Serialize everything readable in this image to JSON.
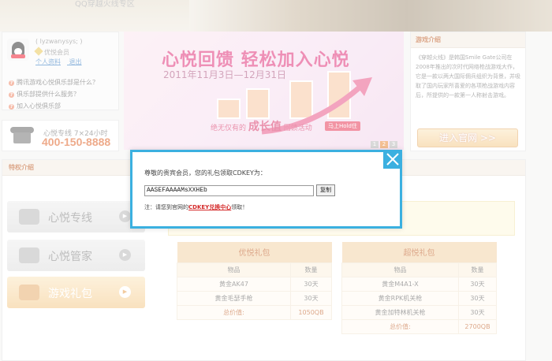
{
  "top_banner": {
    "text": "QQ穿越火线专区"
  },
  "user": {
    "name": "( lyzwanysys; )",
    "vip_label": "优悦会员",
    "links": [
      "个人资料",
      "退出"
    ],
    "faq": [
      "腾讯游戏心悦俱乐部是什么？",
      "俱乐部提供什么服务？",
      "加入心悦俱乐部"
    ]
  },
  "hotline": {
    "label": "心悦专线 7×24小时",
    "number": "400-150-8888"
  },
  "banner": {
    "title": "心悦回馈 轻松加入心悦",
    "date": "2011年11月3日—12月31日",
    "slogan_pre": "绝无仅有的",
    "slogan_big": "成长值",
    "slogan_post": "回馈活动",
    "button": "马上Hold住",
    "pages": [
      "1",
      "2",
      "3"
    ],
    "active_page": "2"
  },
  "intro": {
    "heading": "游戏介绍",
    "text": "《穿越火线》是韩国Smile Gate公司在2008年推出的次时代网络枪战游戏大作，它是一款以两大国际佣兵组织为背景，并吸取了国内玩家所喜爱的各项枪战游戏内容后，所提供的一款第一人称射击游戏。",
    "button": "进入官网 >>"
  },
  "special": {
    "heading": "特权介绍",
    "sidebar": [
      {
        "label": "心悦专线",
        "icon": "phone-icon"
      },
      {
        "label": "心悦管家",
        "icon": "people-icon"
      },
      {
        "label": "游戏礼包",
        "icon": "gift-icon",
        "active": true
      }
    ],
    "tables": [
      {
        "caption": "优悦礼包",
        "headers": [
          "物品",
          "数量"
        ],
        "rows": [
          [
            "黄金AK47",
            "30天"
          ],
          [
            "黄金毛瑟手枪",
            "30天"
          ]
        ],
        "total_label": "总价值:",
        "total_value": "1050QB"
      },
      {
        "caption": "超悦礼包",
        "headers": [
          "物品",
          "数量"
        ],
        "rows": [
          [
            "黄金M4A1-X",
            "30天"
          ],
          [
            "黄金RPK机关枪",
            "30天"
          ],
          [
            "黄金加特林机关枪",
            "30天"
          ]
        ],
        "total_label": "总价值:",
        "total_value": "2700QB"
      }
    ]
  },
  "dialog": {
    "message": "尊敬的贵宾会员，您的礼包领取CDKEY为：",
    "cdkey": "AASEFAAAAMsXXHEb",
    "copy_label": "复制",
    "note_pre": "注：请您到官网的",
    "note_link": "CDKEY兑换中心",
    "note_post": "领取！"
  },
  "colors": {
    "accent": "#3bb0e0",
    "orange": "#e0652a",
    "highlight": "#d42a2a"
  }
}
